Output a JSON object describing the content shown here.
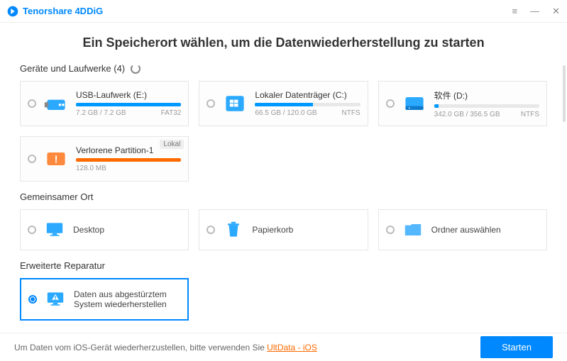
{
  "app": {
    "title": "Tenorshare 4DDiG"
  },
  "headline": "Ein Speicherort wählen, um die Datenwiederherstellung zu starten",
  "sections": {
    "drives_title": "Geräte und Laufwerke (4)",
    "common_title": "Gemeinsamer Ort",
    "repair_title": "Erweiterte Reparatur"
  },
  "drives": [
    {
      "name": "USB-Laufwerk (E:)",
      "size": "7.2 GB / 7.2 GB",
      "fs": "FAT32",
      "fill": 100,
      "color": "blue",
      "icon": "usb"
    },
    {
      "name": "Lokaler Datenträger (C:)",
      "size": "66.5 GB / 120.0 GB",
      "fs": "NTFS",
      "fill": 55,
      "color": "blue",
      "icon": "windows"
    },
    {
      "name": "软件 (D:)",
      "size": "342.0 GB / 356.5 GB",
      "fs": "NTFS",
      "fill": 4,
      "color": "blue",
      "icon": "hdd"
    },
    {
      "name": "Verlorene Partition-1",
      "size": "128.0 MB",
      "fs": "",
      "fill": 100,
      "color": "orange",
      "icon": "lost",
      "badge": "Lokal"
    }
  ],
  "common": [
    {
      "name": "Desktop",
      "icon": "desktop"
    },
    {
      "name": "Papierkorb",
      "icon": "trash"
    },
    {
      "name": "Ordner auswählen",
      "icon": "folder"
    }
  ],
  "repair": {
    "label": "Daten aus abgestürztem System wiederherstellen",
    "selected": true
  },
  "footer": {
    "text": "Um Daten vom iOS-Gerät wiederherzustellen, bitte verwenden Sie ",
    "link": "UltData - iOS",
    "button": "Starten"
  }
}
